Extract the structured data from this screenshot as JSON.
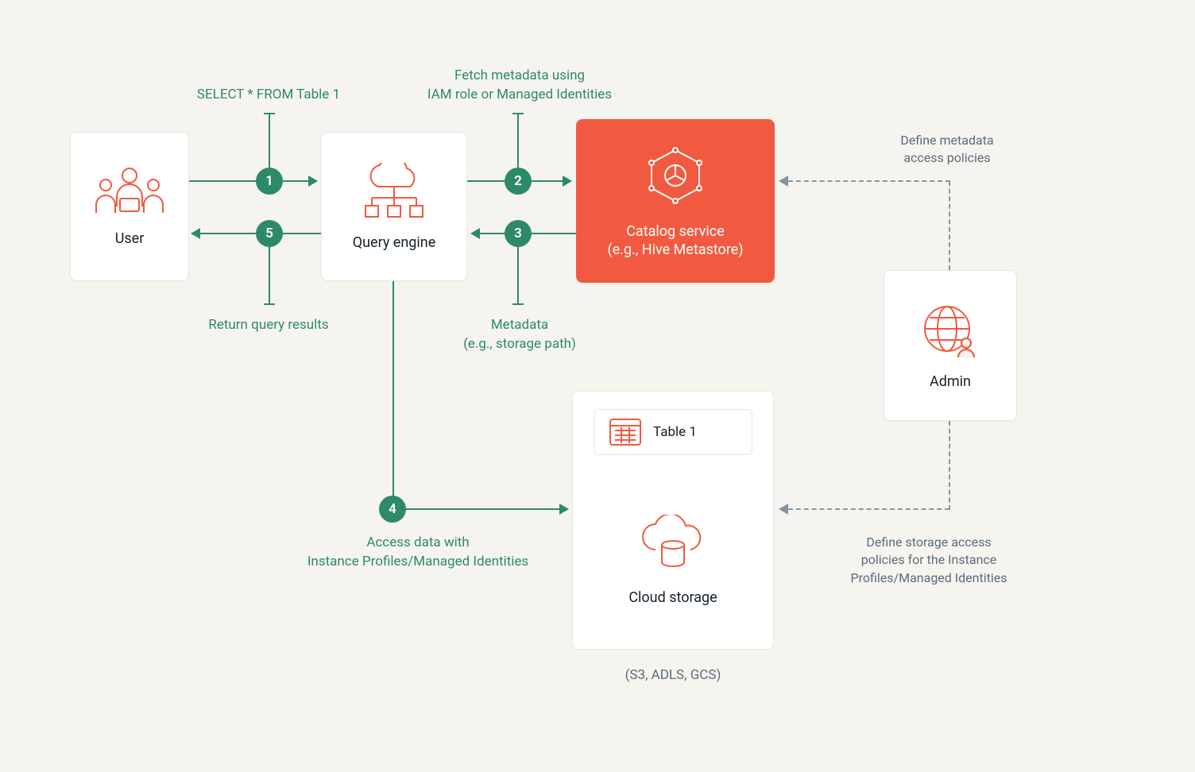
{
  "nodes": {
    "user": {
      "label": "User"
    },
    "query_engine": {
      "label": "Query engine"
    },
    "catalog": {
      "line1": "Catalog service",
      "line2": "(e.g., Hive Metastore)"
    },
    "cloud_storage": {
      "label": "Cloud storage",
      "sub": "(S3, ADLS, GCS)",
      "table": "Table 1"
    },
    "admin": {
      "label": "Admin"
    }
  },
  "steps": {
    "s1": {
      "num": "1",
      "text": "SELECT * FROM Table 1"
    },
    "s2": {
      "num": "2",
      "text_l1": "Fetch metadata using",
      "text_l2": "IAM role or Managed Identities"
    },
    "s3": {
      "num": "3",
      "text_l1": "Metadata",
      "text_l2": "(e.g., storage path)"
    },
    "s4": {
      "num": "4",
      "text_l1": "Access data with",
      "text_l2": "Instance Profiles/Managed Identities"
    },
    "s5": {
      "num": "5",
      "text": "Return query results"
    }
  },
  "admin_notes": {
    "meta": {
      "l1": "Define metadata",
      "l2": "access policies"
    },
    "storage": {
      "l1": "Define storage access",
      "l2": "policies for the Instance",
      "l3": "Profiles/Managed Identities"
    }
  }
}
